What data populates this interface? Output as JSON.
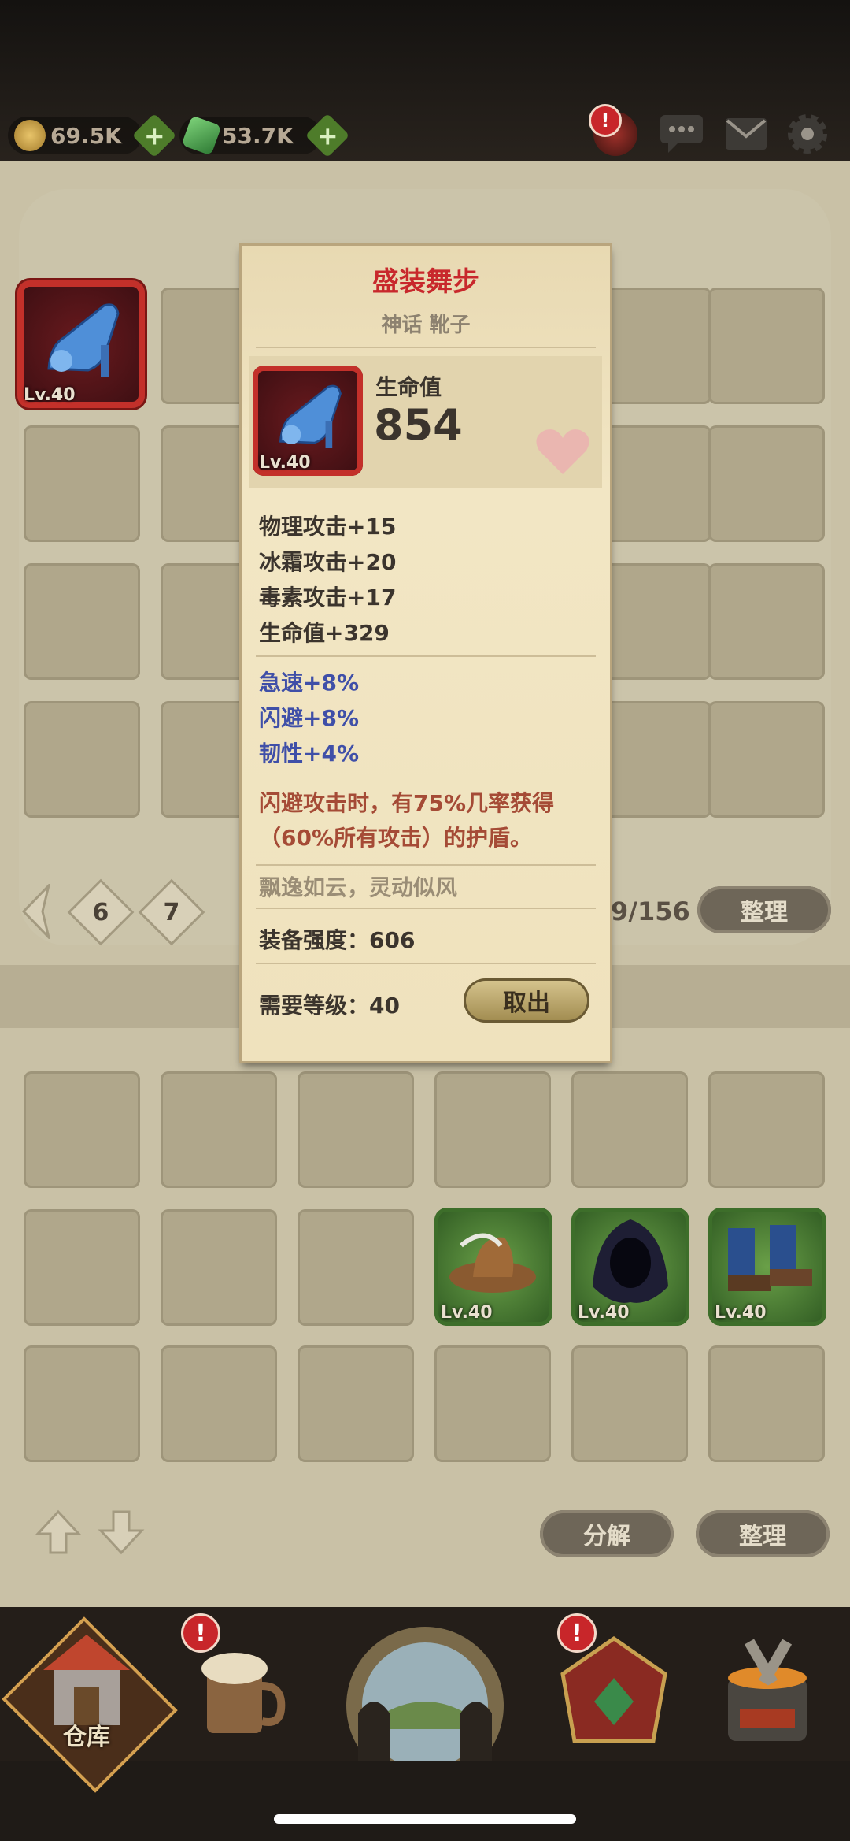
{
  "currencies": [
    {
      "name": "gold",
      "value": "69.5K",
      "icon": "coin-icon"
    },
    {
      "name": "gems",
      "value": "53.7K",
      "icon": "gem-icon"
    }
  ],
  "top_icons": [
    "alert-badge-icon",
    "chat-icon",
    "mail-icon",
    "settings-gear-icon"
  ],
  "upper_grid": {
    "pages": [
      {
        "label": "6"
      },
      {
        "label": "7"
      }
    ],
    "capacity": "9/156",
    "sort_label": "整理"
  },
  "inventory_items": [
    {
      "level": "Lv.40",
      "name": "boot-equipped"
    },
    {
      "level": "Lv.40",
      "name": "hat"
    },
    {
      "level": "Lv.40",
      "name": "hood"
    },
    {
      "level": "Lv.40",
      "name": "boots"
    }
  ],
  "lower_controls": {
    "decompose_label": "分解",
    "sort_label": "整理"
  },
  "nav": [
    {
      "label": "仓库",
      "name": "warehouse"
    },
    {
      "label": "",
      "name": "tavern",
      "badge": "!"
    },
    {
      "label": "",
      "name": "adventure"
    },
    {
      "label": "",
      "name": "shrine",
      "badge": "!"
    },
    {
      "label": "",
      "name": "forge"
    }
  ],
  "tooltip": {
    "title": "盛装舞步",
    "subtitle": "神话 靴子",
    "level": "Lv.40",
    "main_stat_label": "生命值",
    "main_stat_value": "854",
    "stats": [
      "物理攻击+15",
      "冰霜攻击+20",
      "毒素攻击+17",
      "生命值+329"
    ],
    "bonus_stats": [
      "急速+8%",
      "闪避+8%",
      "韧性+4%"
    ],
    "effect": "闪避攻击时，有75%几率获得（60%所有攻击）的护盾。",
    "flavor": "飘逸如云，灵动似风",
    "power_label": "装备强度：606",
    "req_label": "需要等级：40",
    "action_label": "取出"
  },
  "colors": {
    "title": "#c8282c",
    "bonus": "#3f4fa8",
    "effect": "#a54b36"
  }
}
